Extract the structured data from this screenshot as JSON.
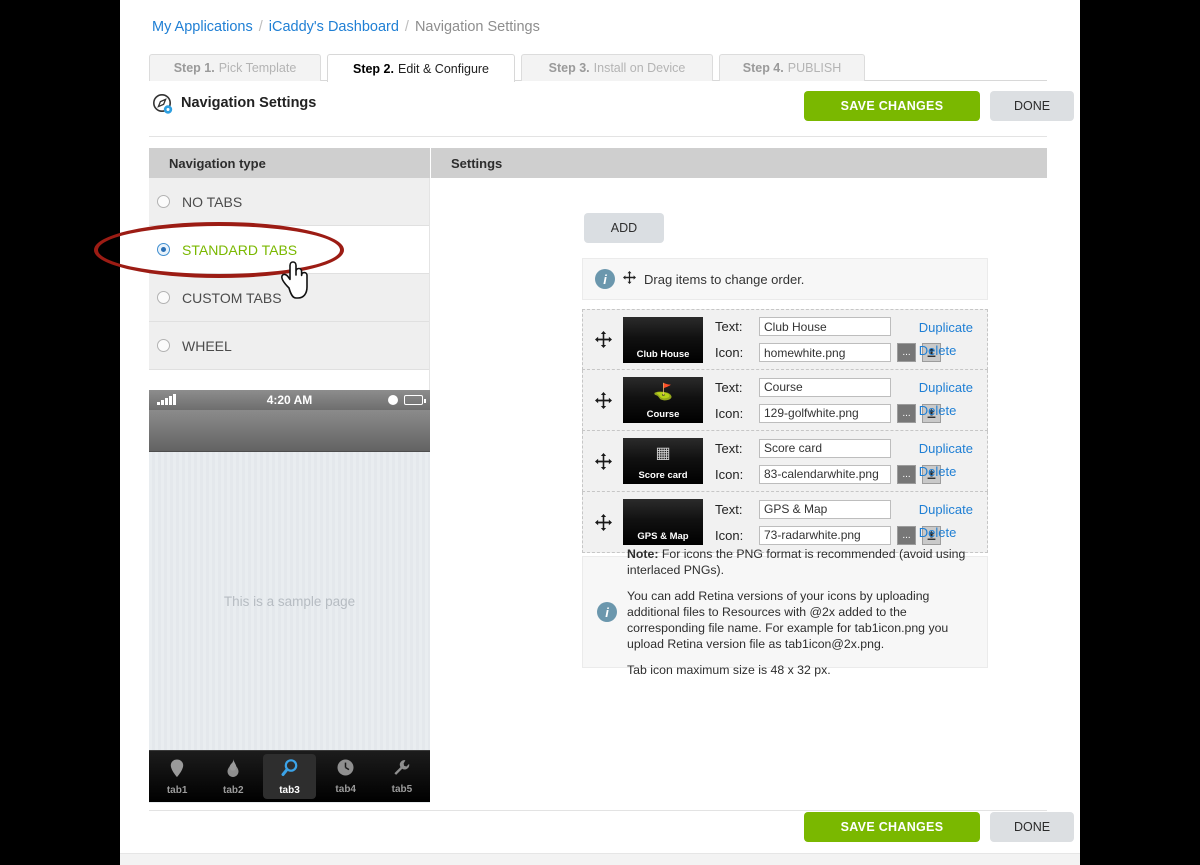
{
  "breadcrumb": {
    "items": [
      "My Applications",
      "iCaddy's Dashboard",
      "Navigation Settings"
    ],
    "separator": "/"
  },
  "steps": [
    {
      "num": "Step 1.",
      "label": "Pick Template",
      "active": false
    },
    {
      "num": "Step 2.",
      "label": "Edit & Configure",
      "active": true
    },
    {
      "num": "Step 3.",
      "label": "Install on Device",
      "active": false
    },
    {
      "num": "Step 4.",
      "label": "PUBLISH",
      "active": false
    }
  ],
  "header": {
    "title": "Navigation Settings",
    "icon": "compass-gear-icon",
    "save_label": "SAVE CHANGES",
    "done_label": "DONE"
  },
  "footer": {
    "save_label": "SAVE CHANGES",
    "done_label": "DONE"
  },
  "left_panel": {
    "header": "Navigation type",
    "options": [
      {
        "label": "NO TABS",
        "selected": false
      },
      {
        "label": "STANDARD TABS",
        "selected": true
      },
      {
        "label": "CUSTOM TABS",
        "selected": false
      },
      {
        "label": "WHEEL",
        "selected": false
      }
    ]
  },
  "phone_preview": {
    "status_time": "4:20 AM",
    "sample_text": "This is a sample page",
    "tabs": [
      {
        "label": "tab1",
        "icon": "location-pin-icon",
        "selected": false
      },
      {
        "label": "tab2",
        "icon": "flame-icon",
        "selected": false
      },
      {
        "label": "tab3",
        "icon": "magnifier-icon",
        "selected": true
      },
      {
        "label": "tab4",
        "icon": "clock-icon",
        "selected": false
      },
      {
        "label": "tab5",
        "icon": "wrench-icon",
        "selected": false
      }
    ]
  },
  "right_panel": {
    "header": "Settings",
    "add_label": "ADD",
    "drag_hint": "Drag items to change order.",
    "field_labels": {
      "text": "Text:",
      "icon": "Icon:"
    },
    "actions": {
      "duplicate": "Duplicate",
      "delete": "Delete"
    },
    "browse_button": "...",
    "upload_button": "upload-icon",
    "items": [
      {
        "thumb_label": "Club House",
        "thumb_glyph": "",
        "text": "Club House",
        "icon": "homewhite.png"
      },
      {
        "thumb_label": "Course",
        "thumb_glyph": "⛳",
        "text": "Course",
        "icon": "129-golfwhite.png"
      },
      {
        "thumb_label": "Score card",
        "thumb_glyph": "▦",
        "text": "Score card",
        "icon": "83-calendarwhite.png"
      },
      {
        "thumb_label": "GPS & Map",
        "thumb_glyph": "",
        "text": "GPS & Map",
        "icon": "73-radarwhite.png"
      }
    ],
    "note": {
      "line1_bold": "Note:",
      "line1": " For icons the PNG format is recommended (avoid using interlaced PNGs).",
      "line2": "You can add Retina versions of your icons by uploading additional files to Resources with @2x added to the corresponding file name. For example for tab1icon.png you upload Retina version file as tab1icon@2x.png.",
      "line3": "Tab icon maximum size is 48 x 32 px."
    }
  },
  "colors": {
    "accent_green": "#7ab800",
    "link_blue": "#1f7fd4",
    "annotation_red": "#9c1c14",
    "header_gray": "#cfcfcf"
  }
}
